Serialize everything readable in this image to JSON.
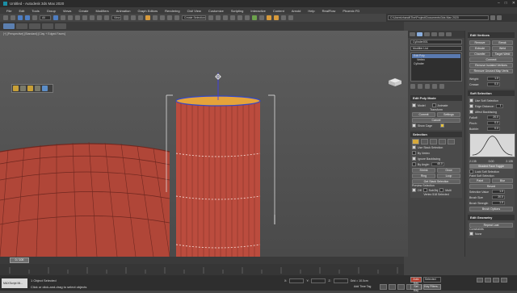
{
  "app": {
    "window_title": "Untitled - Autodesk 3ds Max 2020"
  },
  "menu": [
    "File",
    "Edit",
    "Tools",
    "Group",
    "Views",
    "Create",
    "Modifiers",
    "Animation",
    "Graph Editors",
    "Rendering",
    "Civil View",
    "Customize",
    "Scripting",
    "Interactive",
    "Content",
    "Arnold",
    "Help",
    "RealFlow",
    "Phoenix FD"
  ],
  "toolbar2": {
    "selection_set": "Create Selection Se"
  },
  "pathbar": {
    "path": "C:\\Users\\rhandi\\The\\Project\\Documents\\3ds Max 2020"
  },
  "viewport": {
    "label": "[+] [Perspective] [Standard] [Clay + Edged Faces]"
  },
  "command_panel": {
    "object_name": "Cylinder001",
    "modifier_list": "Modifier List",
    "stack": [
      "Edit Poly",
      "Vertex",
      "Cylinder"
    ],
    "edit_poly_mode": {
      "header": "Edit Poly Mode",
      "model": "Model",
      "animate": "Animate",
      "transform": "Transform",
      "commit": "Commit",
      "settings": "Settings",
      "cancel": "Cancel",
      "show_cage": "Show Cage"
    },
    "selection": {
      "header": "Selection",
      "use_stack": "Use Stack Selection",
      "by_vertex": "By Vertex",
      "ignore_backfacing": "Ignore Backfacing",
      "by_angle": "By Angle:",
      "angle": "45.0",
      "shrink": "Shrink",
      "grow": "Grow",
      "ring": "Ring",
      "loop": "Loop",
      "get_stack": "Get Stack Selection",
      "preview": "Preview Selection",
      "off": "Off",
      "subobj": "SubObj",
      "multi": "Multi",
      "status": "Vertex 518 Selected"
    },
    "edit_vertices": {
      "header": "Edit Vertices",
      "remove": "Remove",
      "break": "Break",
      "extrude": "Extrude",
      "weld": "Weld",
      "chamfer": "Chamfer",
      "target_weld": "Target Weld",
      "connect": "Connect",
      "remove_isolated": "Remove Isolated Vertices",
      "remove_unused": "Remove Unused Map Verts",
      "weight_label": "Weight:",
      "weight": "1.0",
      "crease_label": "Crease:",
      "crease": "0.0"
    },
    "soft_selection": {
      "header": "Soft Selection",
      "use_soft": "Use Soft Selection",
      "edge_distance": "Edge Distance:",
      "edge_dist_val": "1",
      "affect_backfacing": "Affect Backfacing",
      "falloff_label": "Falloff:",
      "falloff": "20.0",
      "pinch_label": "Pinch:",
      "pinch": "0.0",
      "bubble_label": "Bubble:",
      "bubble": "0.0",
      "curve_ticks": [
        "2.135",
        "0.00",
        "2.135"
      ],
      "shaded_face": "Shaded Face Toggle",
      "lock_soft": "Lock Soft Selection",
      "paint_soft": "Paint Soft Selection",
      "paint": "Paint",
      "blur": "Blur",
      "revert": "Revert",
      "sel_value_label": "Selection Value",
      "sel_value": "1.0",
      "brush_size_label": "Brush Size",
      "brush_size": "20.0",
      "brush_strength_label": "Brush Strength",
      "brush_strength": "1.0",
      "brush_options": "Brush Options"
    },
    "edit_geometry": {
      "header": "Edit Geometry",
      "repeat_last": "Repeat Last",
      "constraints": "Constraints",
      "none": "None"
    }
  },
  "timeline": {
    "slider": "0 / 100"
  },
  "status": {
    "maxscript": "MAXScript Mi...",
    "objects": "1 Object Selected",
    "prompt": "Click or click-and-drag to select objects",
    "x_label": "X:",
    "x": "",
    "y_label": "Y:",
    "y": "",
    "z_label": "Z:",
    "z": "",
    "grid": "Grid = 10.0cm",
    "add_time_tag": "Add Time Tag",
    "auto_key": "Auto Key",
    "set_key": "Set Key",
    "selected": "Selected",
    "key_filters": "Key Filters...",
    "frame": "0"
  },
  "colors": {
    "object_red": "#b94a3c",
    "selection_orange": "#e5a33a",
    "accent_blue": "#5a7ab0"
  }
}
